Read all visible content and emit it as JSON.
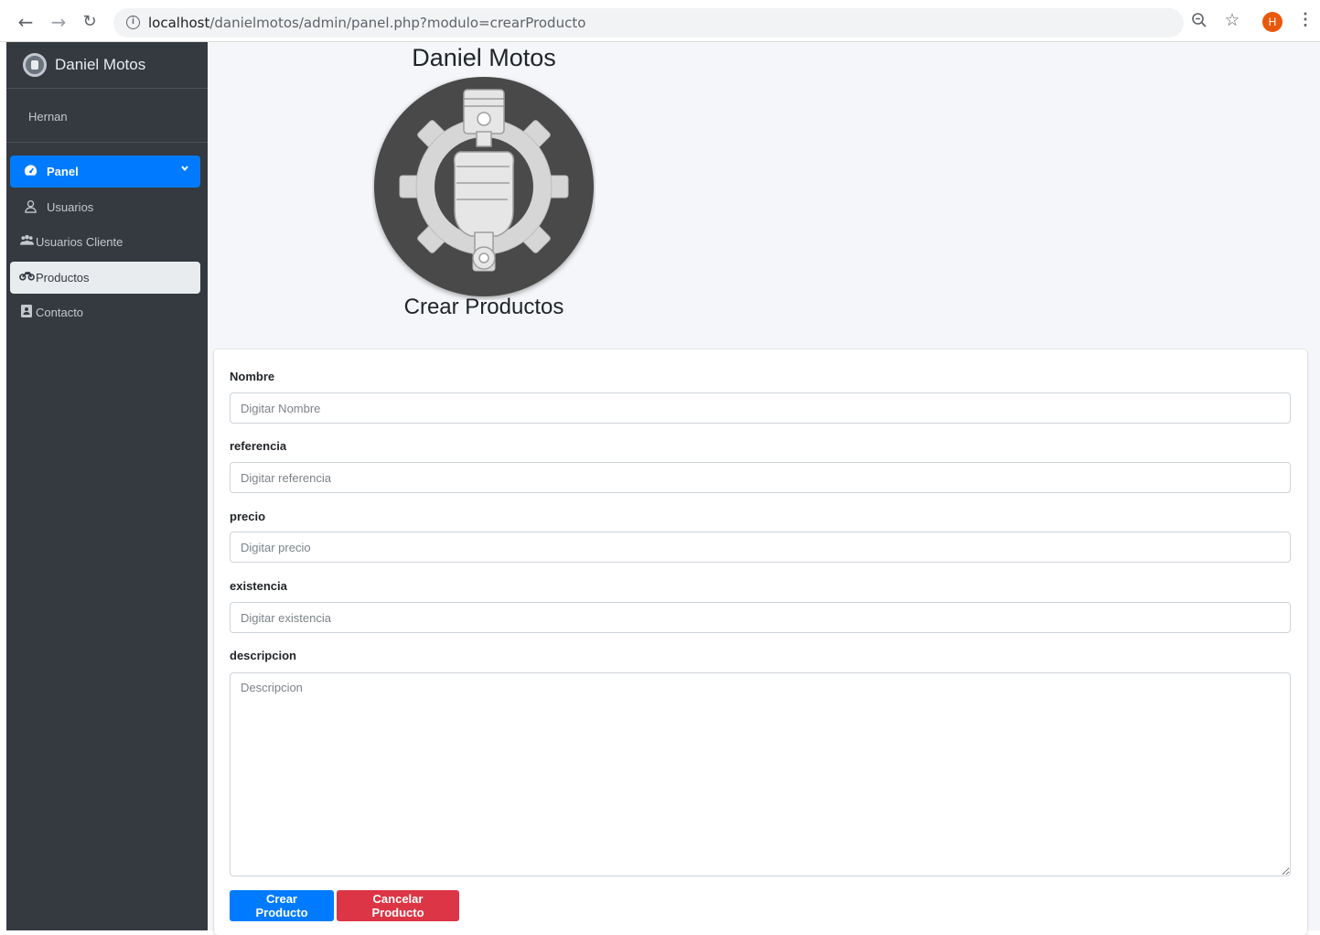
{
  "browser": {
    "url_host": "localhost",
    "url_path": "/danielmotos/admin/panel.php?modulo=crearProducto",
    "profile_initial": "H"
  },
  "sidebar": {
    "brand": "Daniel Motos",
    "user": "Hernan",
    "items": [
      {
        "label": "Panel",
        "icon": "tachometer-icon",
        "active": true
      },
      {
        "label": "Usuarios",
        "icon": "user-icon"
      },
      {
        "label": "Usuarios Cliente",
        "icon": "users-icon"
      },
      {
        "label": "Productos",
        "icon": "motorcycle-icon",
        "selected": true
      },
      {
        "label": "Contacto",
        "icon": "address-card-icon"
      }
    ]
  },
  "main": {
    "site_title": "Daniel Motos",
    "heading": "Crear Productos"
  },
  "form": {
    "fields": [
      {
        "label": "Nombre",
        "placeholder": "Digitar Nombre",
        "value": ""
      },
      {
        "label": "referencia",
        "placeholder": "Digitar referencia",
        "value": ""
      },
      {
        "label": "precio",
        "placeholder": "Digitar precio",
        "value": ""
      },
      {
        "label": "existencia",
        "placeholder": "Digitar existencia",
        "value": ""
      },
      {
        "label": "descripcion",
        "placeholder": "Descripcion",
        "value": ""
      }
    ],
    "submit_label": "Crear Producto",
    "cancel_label": "Cancelar Producto"
  },
  "colors": {
    "primary": "#007bff",
    "danger": "#dc3545",
    "sidebar_bg": "#343a40",
    "main_bg": "#f4f6f9"
  }
}
